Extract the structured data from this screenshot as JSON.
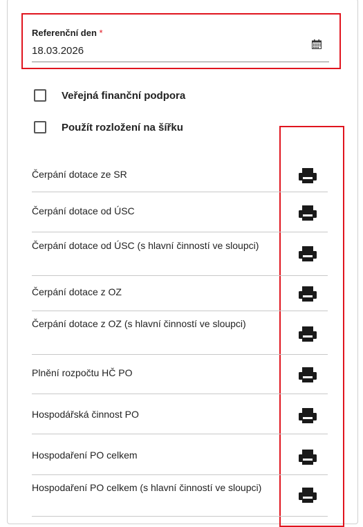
{
  "reference_date": {
    "label": "Referenční den",
    "required_mark": "*",
    "value": "18.03.2026",
    "icon": "calendar-icon"
  },
  "options": [
    {
      "label": "Veřejná finanční podpora",
      "checked": false
    },
    {
      "label": "Použít rozložení na šířku",
      "checked": false
    }
  ],
  "reports": [
    {
      "label": "Čerpání dotace ze SR",
      "icon": "printer-icon"
    },
    {
      "label": "Čerpání dotace od ÚSC",
      "icon": "printer-icon"
    },
    {
      "label": "Čerpání dotace od ÚSC (s hlavní činností ve sloupci)",
      "icon": "printer-icon"
    },
    {
      "label": "Čerpání dotace z OZ",
      "icon": "printer-icon"
    },
    {
      "label": "Čerpání dotace z OZ (s hlavní činností ve sloupci)",
      "icon": "printer-icon"
    },
    {
      "label": "Plnění rozpočtu HČ PO",
      "icon": "printer-icon"
    },
    {
      "label": "Hospodářská činnost PO",
      "icon": "printer-icon"
    },
    {
      "label": "Hospodaření PO celkem",
      "icon": "printer-icon"
    },
    {
      "label": "Hospodaření PO celkem (s hlavní činností ve sloupci)",
      "icon": "printer-icon"
    }
  ],
  "colors": {
    "highlight": "#e0141e",
    "text": "#222222",
    "divider": "#c8c8c8"
  }
}
